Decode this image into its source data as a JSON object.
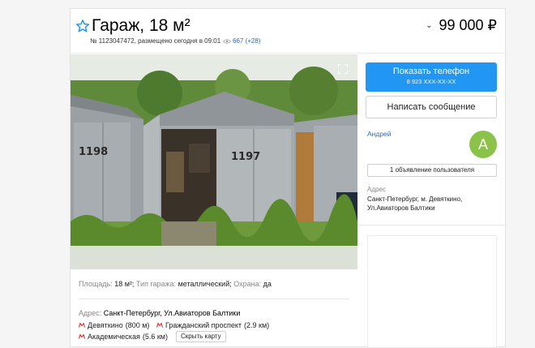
{
  "listing": {
    "title": "Гараж, 18 м²",
    "meta": "№ 1123047472, размещено сегодня в 09:01",
    "views": "667 (+28)",
    "price": "99 000 ₽"
  },
  "photo": {
    "left_gate_number": "1198",
    "center_gate_number": "1197"
  },
  "contact": {
    "show_phone_label": "Показать телефон",
    "phone_masked": "8 923 XXX-XX-XX",
    "message_label": "Написать сообщение",
    "seller_name": "Андрей",
    "avatar_letter": "А",
    "ads_count": "1 объявление пользователя",
    "address_label": "Адрес",
    "address_text": "Санкт-Петербург, м. Девяткино, Ул.Авиаторов Балтики"
  },
  "params": [
    {
      "key": "Площадь:",
      "value": "18 м²;"
    },
    {
      "key": "Тип гаража:",
      "value": "металлический;"
    },
    {
      "key": "Охрана:",
      "value": "да"
    }
  ],
  "address": {
    "label": "Адрес:",
    "value": "Санкт-Петербург, Ул.Авиаторов Балтики",
    "metro": [
      {
        "name": "Девяткино",
        "distance": "(800 м)"
      },
      {
        "name": "Гражданский проспект",
        "distance": "(2.9 км)"
      },
      {
        "name": "Академическая",
        "distance": "(5.6 км)"
      }
    ],
    "hide_map_label": "Скрыть карту"
  },
  "colors": {
    "accent_blue": "#2196f3",
    "link_blue": "#2a6ab8",
    "avatar_green": "#8bc34a",
    "metro_red": "#d32f2f"
  },
  "icons": {
    "favorite": "star-outline-icon",
    "views": "eye-icon",
    "price_toggle": "chevron-down-icon",
    "fullscreen": "fullscreen-icon",
    "metro": "metro-icon"
  }
}
